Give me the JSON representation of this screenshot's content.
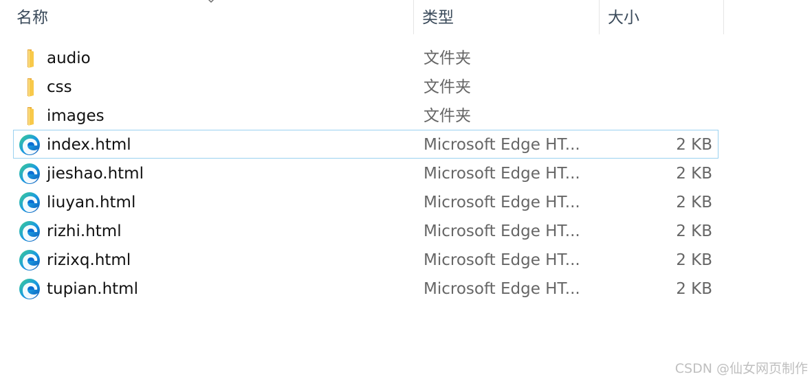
{
  "columns": {
    "name": "名称",
    "type": "类型",
    "size": "大小"
  },
  "files": [
    {
      "name": "audio",
      "type": "文件夹",
      "size": "",
      "icon": "folder-icon"
    },
    {
      "name": "css",
      "type": "文件夹",
      "size": "",
      "icon": "folder-icon"
    },
    {
      "name": "images",
      "type": "文件夹",
      "size": "",
      "icon": "folder-icon"
    },
    {
      "name": "index.html",
      "type": "Microsoft Edge HT...",
      "size": "2 KB",
      "icon": "edge-icon",
      "selected": true
    },
    {
      "name": "jieshao.html",
      "type": "Microsoft Edge HT...",
      "size": "2 KB",
      "icon": "edge-icon"
    },
    {
      "name": "liuyan.html",
      "type": "Microsoft Edge HT...",
      "size": "2 KB",
      "icon": "edge-icon"
    },
    {
      "name": "rizhi.html",
      "type": "Microsoft Edge HT...",
      "size": "2 KB",
      "icon": "edge-icon"
    },
    {
      "name": "rizixq.html",
      "type": "Microsoft Edge HT...",
      "size": "2 KB",
      "icon": "edge-icon"
    },
    {
      "name": "tupian.html",
      "type": "Microsoft Edge HT...",
      "size": "2 KB",
      "icon": "edge-icon"
    }
  ],
  "watermark": "CSDN @仙女网页制作",
  "colors": {
    "selection_border": "#99d1f0",
    "folder": "#f8c94a",
    "edge_blue": "#0a6fd4",
    "edge_green": "#3fcf8e"
  }
}
